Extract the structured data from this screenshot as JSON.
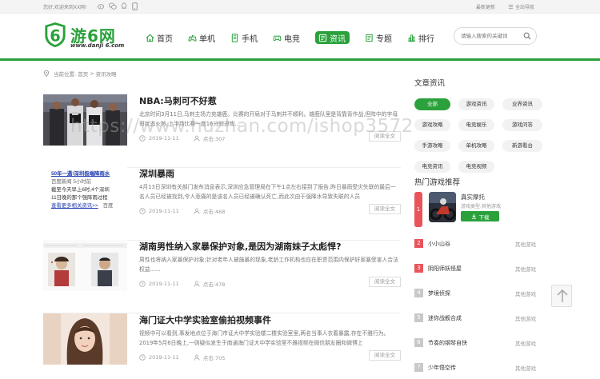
{
  "topbar": {
    "welcome": "您好,欢迎来到XX网!",
    "right_links": [
      "最新更新",
      "全站导航"
    ]
  },
  "logo": {
    "brand": "游6网",
    "url": "www.danji 6.com"
  },
  "nav": [
    {
      "label": "首页",
      "icon": "home-icon"
    },
    {
      "label": "单机",
      "icon": "gamepad-icon"
    },
    {
      "label": "手机",
      "icon": "mobile-icon"
    },
    {
      "label": "电竞",
      "icon": "controller-icon"
    },
    {
      "label": "资讯",
      "icon": "news-icon",
      "active": true
    },
    {
      "label": "专题",
      "icon": "topic-icon"
    },
    {
      "label": "排行",
      "icon": "rank-icon"
    }
  ],
  "search": {
    "placeholder": "请输入搜索的关键词"
  },
  "breadcrumb": {
    "prefix": "当前位置:",
    "home": "首页",
    "sep": ">",
    "current": "资讯攻略"
  },
  "articles": [
    {
      "title": "NBA:马刺可不好惹",
      "desc": "北京时间3月11日,马刺主场力克雄鹿。比赛的开局对于马刺并不顺利。雄鹿队里是背靠背作战,但阵中的字母哥状态火热,上半场比赛一度16分的进攻...",
      "date": "2019-11-11",
      "clicks": "点击:307",
      "read": "阅读全文"
    },
    {
      "title": "深圳暴雨",
      "desc": "4月13日深圳有关部门发布消息表示,深圳应急管理局在下午1点左右接到了报告,昨日暴雨受灾失联的最后一名人员已经被找到,令人悲痛的是该名人员已经被确认死亡,而此次由于强降水导致失联的人员",
      "date": "2019-11-11",
      "clicks": "点击:468",
      "read": "阅读全文"
    },
    {
      "title": "湖南男性纳入家暴保护对象,是因为湖南妹子太彪悍?",
      "desc": "男性也将纳入家暴保护对象;针对老年人被施暴的现象,老龄工作机构也应在职责范围内保护好家暴受害人合法权益......",
      "date": "2019-11-11",
      "clicks": "点击:478",
      "read": "阅读全文"
    },
    {
      "title": "海门证大中学实验室偷拍视频事件",
      "desc": "视频中可以看到,事发地点位于海门市证大中学实验楼二楼实验室里,两名当事人衣着暴露,存在不雅行为。2019年5月6日晚上,一则疑似发生于南通海门证大中学实验室不雅视频在微信朋友圈和微博上",
      "date": "2019-11-11",
      "clicks": "点击:705",
      "read": "阅读全文"
    }
  ],
  "thumb2_text": {
    "line1": "50年一遇!深圳极端降雨水",
    "line2": "百度新闻 5小时前",
    "line3": "截至今天早上6时,4个深圳",
    "line4": "11日晚的那个强降雨过程",
    "line5": "查看更多相关资讯>>",
    "line6": "百度"
  },
  "sidebar": {
    "news_title": "文章资讯",
    "tags": [
      {
        "label": "全部",
        "active": true
      },
      {
        "label": "游戏资讯"
      },
      {
        "label": "业界资讯"
      },
      {
        "label": "游戏攻略"
      },
      {
        "label": "电竞娱乐"
      },
      {
        "label": "游戏问答"
      },
      {
        "label": "手游攻略"
      },
      {
        "label": "单机攻略"
      },
      {
        "label": "新游看台"
      },
      {
        "label": "电竞资讯"
      },
      {
        "label": "电竞视频"
      }
    ],
    "hot_title": "热门游戏推荐",
    "hot_first": {
      "rank": "1",
      "name": "真实摩托",
      "type": "游戏类型:其他游戏",
      "download": "下载"
    },
    "hot_list": [
      {
        "rank": "2",
        "name": "小小山谷",
        "type": "其他游戏"
      },
      {
        "rank": "3",
        "name": "阴阳师妖怪屋",
        "type": "其他游戏"
      },
      {
        "rank": "4",
        "name": "梦境侦探",
        "type": "其他游戏"
      },
      {
        "rank": "5",
        "name": "迷你战舰合成",
        "type": "其他游戏"
      },
      {
        "rank": "6",
        "name": "节奏的钢琴自快",
        "type": "其他游戏"
      },
      {
        "rank": "7",
        "name": "少年悟空传",
        "type": "其他游戏"
      }
    ]
  },
  "watermark": "https://www.huzhan.com/ishop3572"
}
